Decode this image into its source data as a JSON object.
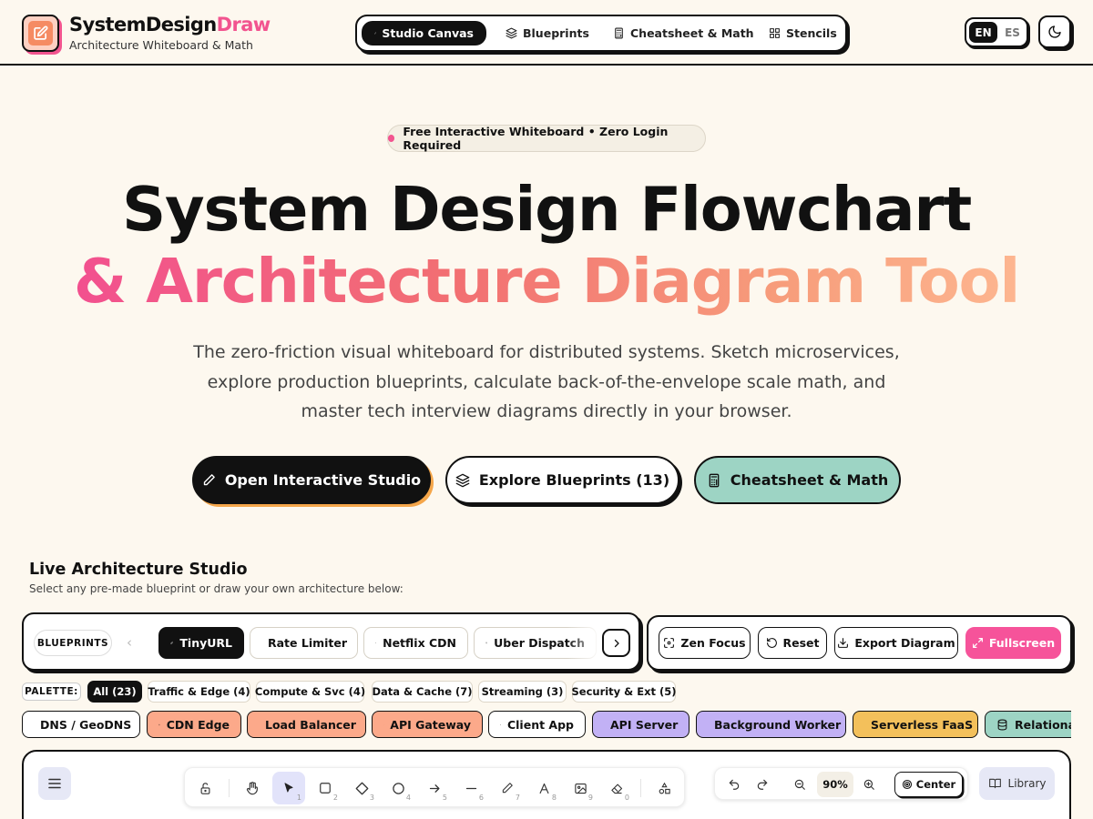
{
  "header": {
    "brand_main": "SystemDesign",
    "brand_accent": "Draw",
    "tagline": "Architecture Whiteboard & Math",
    "nav": [
      {
        "label": "Studio Canvas",
        "icon": "pencil-icon"
      },
      {
        "label": "Blueprints",
        "icon": "layers-icon"
      },
      {
        "label": "Cheatsheet & Math",
        "icon": "calculator-icon"
      },
      {
        "label": "Stencils",
        "icon": "grid-icon"
      }
    ],
    "lang": {
      "active": "EN",
      "other": "ES"
    },
    "theme_icon": "moon-icon"
  },
  "hero": {
    "badge": "Free Interactive Whiteboard • Zero Login Required",
    "title_line1": "System Design Flowchart",
    "title_line2": "& Architecture Diagram Tool",
    "lead": "The zero-friction visual whiteboard for distributed systems. Sketch microservices, explore production blueprints, calculate back-of-the-envelope scale math, and master tech interview diagrams directly in your browser.",
    "cta": [
      {
        "label": "Open Interactive Studio",
        "icon": "pencil-icon"
      },
      {
        "label": "Explore Blueprints (13)",
        "icon": "layers-icon"
      },
      {
        "label": "Cheatsheet & Math",
        "icon": "calculator-icon"
      }
    ]
  },
  "studio": {
    "title": "Live Architecture Studio",
    "subtitle": "Select any pre-made blueprint or draw your own architecture below:",
    "blueprints_label": "BLUEPRINTS",
    "blueprints": [
      {
        "label": "TinyURL",
        "icon": "link-icon",
        "active": true
      },
      {
        "label": "Rate Limiter",
        "icon": "shield-icon"
      },
      {
        "label": "Netflix CDN",
        "icon": "video-icon"
      },
      {
        "label": "Uber Dispatch",
        "icon": "map-pin-icon"
      }
    ],
    "actions": [
      {
        "label": "Zen Focus",
        "icon": "focus-icon"
      },
      {
        "label": "Reset",
        "icon": "rotate-ccw-icon"
      },
      {
        "label": "Export Diagram",
        "icon": "download-icon"
      },
      {
        "label": "Fullscreen",
        "icon": "expand-icon"
      }
    ],
    "palette_label": "PALETTE:",
    "palette_filters": [
      {
        "label": "All (23)",
        "active": true
      },
      {
        "label": "Traffic & Edge (4)"
      },
      {
        "label": "Compute & Svc (4)"
      },
      {
        "label": "Data & Cache (7)"
      },
      {
        "label": "Streaming (3)"
      },
      {
        "label": "Security & Ext (5)"
      }
    ],
    "components": [
      {
        "label": "DNS / GeoDNS",
        "icon": "globe-icon",
        "color": "#ffffff"
      },
      {
        "label": "CDN Edge",
        "icon": "cdn-icon",
        "color": "#fca98a"
      },
      {
        "label": "Load Balancer",
        "icon": "share-icon",
        "color": "#fca98a"
      },
      {
        "label": "API Gateway",
        "icon": "globe-icon",
        "color": "#fca98a"
      },
      {
        "label": "Client App",
        "icon": "monitor-icon",
        "color": "#ffffff"
      },
      {
        "label": "API Server",
        "icon": "server-icon",
        "color": "#c2b1f5"
      },
      {
        "label": "Background Worker",
        "icon": "gear-icon",
        "color": "#c2b1f5"
      },
      {
        "label": "Serverless FaaS",
        "icon": "bolt-icon",
        "color": "#f3c05b"
      },
      {
        "label": "Relational",
        "icon": "database-icon",
        "color": "#9dd4c4"
      }
    ],
    "zoom": "90%",
    "center_label": "Center",
    "library_label": "Library"
  }
}
